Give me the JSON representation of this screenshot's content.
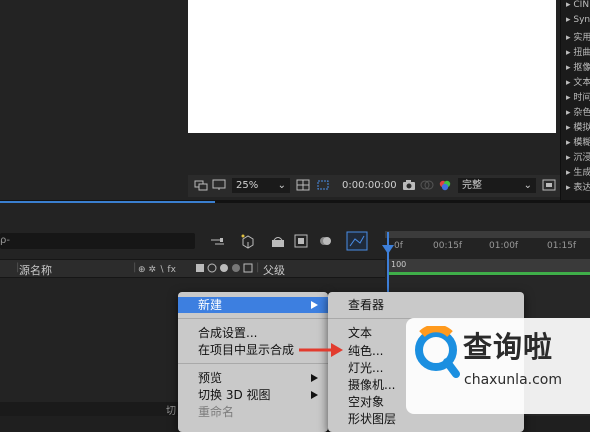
{
  "viewer": {
    "zoom": "25%",
    "timecode": "0:00:00:00",
    "quality": "完整"
  },
  "effects_panel": {
    "items": [
      "CIN",
      "Syn",
      "实用",
      "扭曲",
      "抠像",
      "文本",
      "时间",
      "杂色",
      "模拟",
      "模糊",
      "沉浸",
      "生成",
      "表达"
    ]
  },
  "timeline": {
    "search_placeholder": "ρ-",
    "source_name_header": "源名称",
    "parent_header": "父级",
    "ruler_ticks": [
      "0f",
      "00:15f",
      "01:00f",
      "01:15f"
    ],
    "layer_label": "100",
    "bottom_label": "切"
  },
  "context_menu": {
    "items": [
      {
        "label": "新建",
        "highlighted": true,
        "submenu": true
      },
      {
        "label": "合成设置..."
      },
      {
        "label": "在项目中显示合成"
      },
      {
        "label": "预览",
        "submenu": true
      },
      {
        "label": "切换 3D 视图",
        "submenu": true
      },
      {
        "label": "重命名",
        "disabled": true
      }
    ]
  },
  "new_submenu": {
    "items": [
      {
        "label": "查看器"
      },
      {
        "label": "文本"
      },
      {
        "label": "纯色..."
      },
      {
        "label": "灯光..."
      },
      {
        "label": "摄像机..."
      },
      {
        "label": "空对象"
      },
      {
        "label": "形状图层"
      }
    ]
  },
  "watermark": {
    "text": "查询啦",
    "url": "chaxunla.com"
  },
  "colors": {
    "accent_blue": "#3d7fe0",
    "playhead_blue": "#3e7fd8",
    "layer_green": "#3fae49",
    "arrow_red": "#e23b2e"
  }
}
